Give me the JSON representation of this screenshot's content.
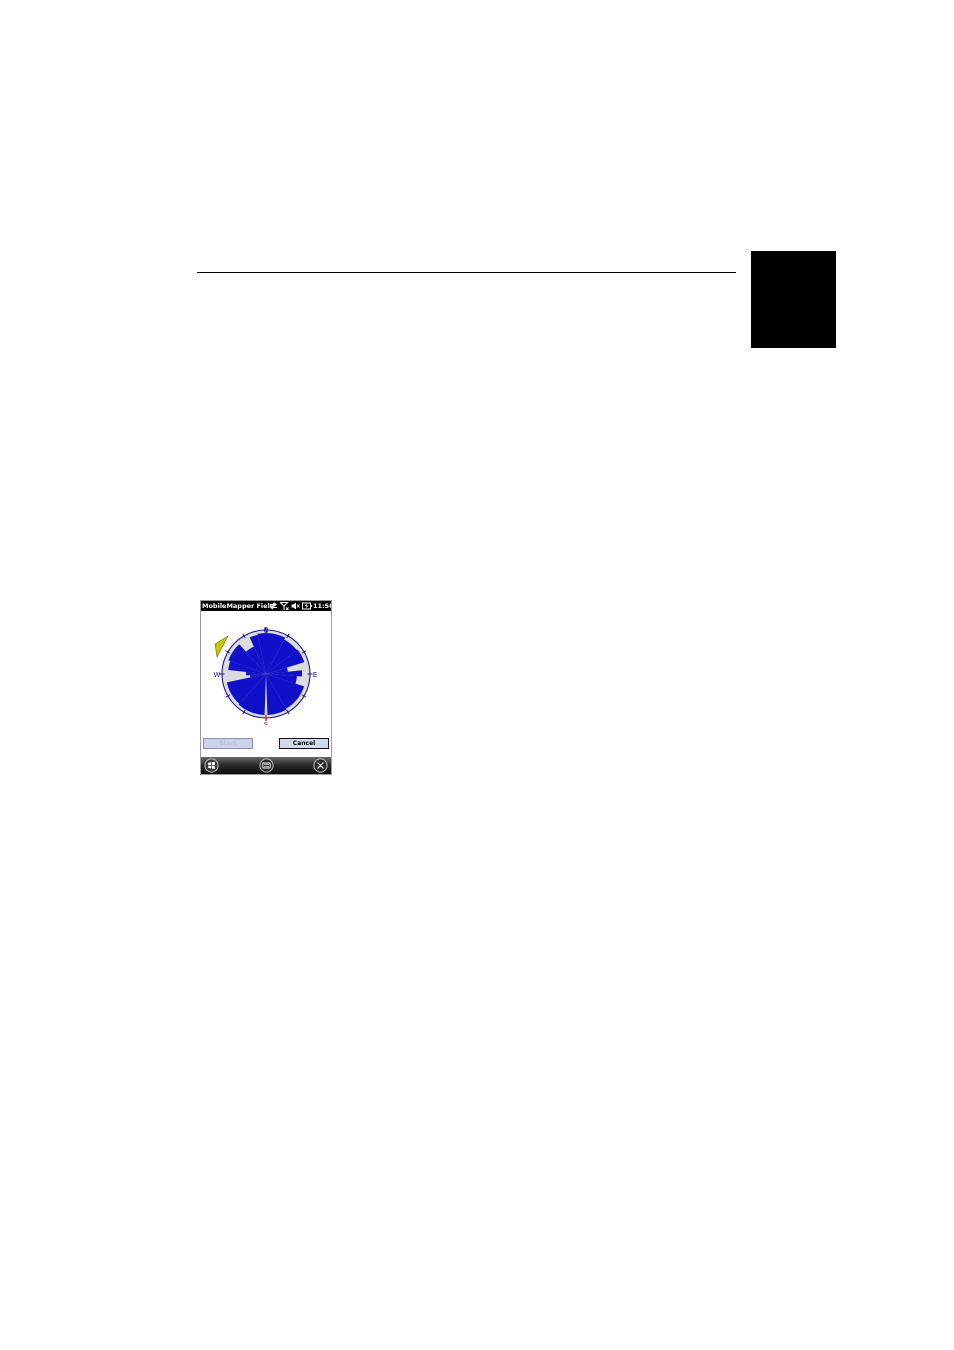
{
  "page": {
    "tab_color": "#000000",
    "rule_color": "#000000"
  },
  "device": {
    "status_bar": {
      "app_title": "MobileMapper Field",
      "clock": "11:56",
      "icons": [
        "sync-arrows-icon",
        "signal-antenna-icon",
        "speaker-muted-icon",
        "battery-charging-icon"
      ]
    },
    "sky_plot": {
      "cardinals": {
        "north": "N",
        "south": "S",
        "east": "E",
        "west": "W"
      },
      "fill_color": "#1010c8",
      "ring_color": "#1a1a8c",
      "background_color": "#dcdcdc",
      "indicator_color": "#c8c800"
    },
    "buttons": {
      "start_label": "Start",
      "cancel_label": "Cancel"
    },
    "taskbar": {
      "icons": [
        "windows-start-icon",
        "keyboard-icon",
        "close-icon"
      ]
    }
  }
}
